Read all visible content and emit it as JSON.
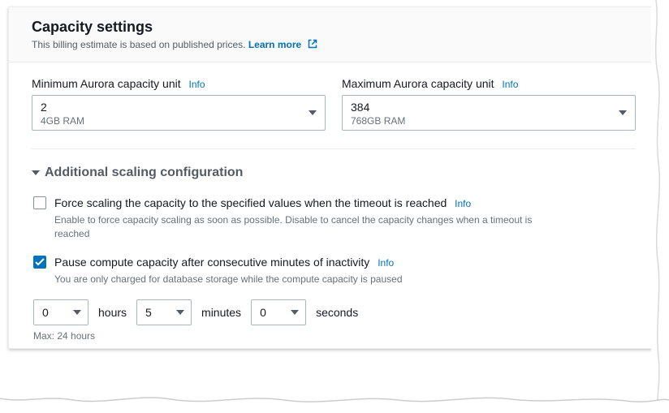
{
  "header": {
    "title": "Capacity settings",
    "subtitle": "This billing estimate is based on published prices.",
    "learn_more": "Learn more"
  },
  "capacity": {
    "min": {
      "label": "Minimum Aurora capacity unit",
      "info": "Info",
      "value": "2",
      "sub": "4GB RAM"
    },
    "max": {
      "label": "Maximum Aurora capacity unit",
      "info": "Info",
      "value": "384",
      "sub": "768GB RAM"
    }
  },
  "scaling": {
    "section_title": "Additional scaling configuration",
    "force": {
      "label": "Force scaling the capacity to the specified values when the timeout is reached",
      "info": "Info",
      "desc": "Enable to force capacity scaling as soon as possible. Disable to cancel the capacity changes when a timeout is reached",
      "checked": false
    },
    "pause": {
      "label": "Pause compute capacity after consecutive minutes of inactivity",
      "info": "Info",
      "desc": "You are only charged for database storage while the compute capacity is paused",
      "checked": true
    },
    "time": {
      "hours": "0",
      "hours_unit": "hours",
      "minutes": "5",
      "minutes_unit": "minutes",
      "seconds": "0",
      "seconds_unit": "seconds",
      "max_hint": "Max: 24 hours"
    }
  }
}
